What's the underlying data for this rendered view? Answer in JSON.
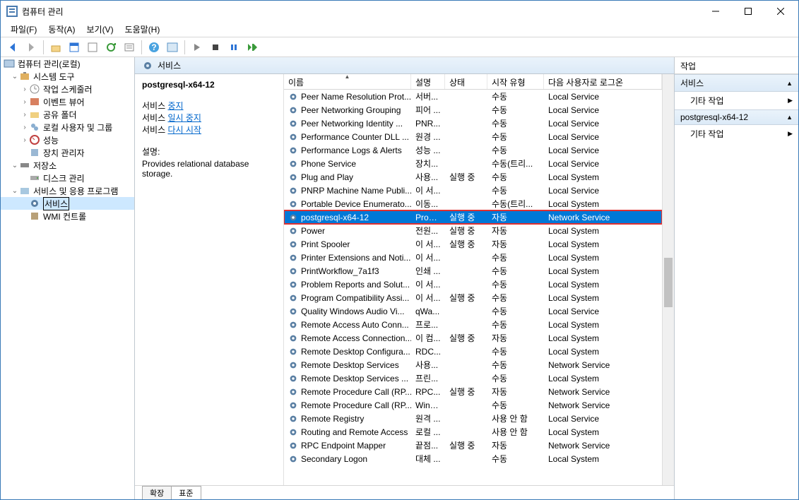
{
  "window": {
    "title": "컴퓨터 관리"
  },
  "menubar": [
    "파일(F)",
    "동작(A)",
    "보기(V)",
    "도움말(H)"
  ],
  "tree": {
    "root": "컴퓨터 관리(로컬)",
    "system_tools": "시스템 도구",
    "task_scheduler": "작업 스케줄러",
    "event_viewer": "이벤트 뷰어",
    "shared_folders": "공유 폴더",
    "local_users": "로컬 사용자 및 그룹",
    "performance": "성능",
    "device_mgr": "장치 관리자",
    "storage": "저장소",
    "disk_mgmt": "디스크 관리",
    "services_apps": "서비스 및 응용 프로그램",
    "services": "서비스",
    "wmi": "WMI 컨트롤"
  },
  "center": {
    "header": "서비스",
    "selected_name": "postgresql-x64-12",
    "service_label": "서비스",
    "stop": "중지",
    "pause": "일시 중지",
    "restart": "다시 시작",
    "desc_label": "설명:",
    "desc_text": "Provides relational database storage."
  },
  "columns": {
    "name": "이름",
    "desc": "설명",
    "status": "상태",
    "startup": "시작 유형",
    "logon": "다음 사용자로 로그온"
  },
  "tabs": {
    "extended": "확장",
    "standard": "표준"
  },
  "actions": {
    "header": "작업",
    "group1": "서비스",
    "other_actions": "기타 작업",
    "group2": "postgresql-x64-12"
  },
  "rows": [
    {
      "name": "Peer Name Resolution Prot...",
      "desc": "서버...",
      "status": "",
      "startup": "수동",
      "logon": "Local Service"
    },
    {
      "name": "Peer Networking Grouping",
      "desc": "피어 ...",
      "status": "",
      "startup": "수동",
      "logon": "Local Service"
    },
    {
      "name": "Peer Networking Identity ...",
      "desc": "PNR...",
      "status": "",
      "startup": "수동",
      "logon": "Local Service"
    },
    {
      "name": "Performance Counter DLL ...",
      "desc": "원경 ...",
      "status": "",
      "startup": "수동",
      "logon": "Local Service"
    },
    {
      "name": "Performance Logs & Alerts",
      "desc": "성능 ...",
      "status": "",
      "startup": "수동",
      "logon": "Local Service"
    },
    {
      "name": "Phone Service",
      "desc": "장치...",
      "status": "",
      "startup": "수동(트리...",
      "logon": "Local Service"
    },
    {
      "name": "Plug and Play",
      "desc": "사용...",
      "status": "실행 중",
      "startup": "수동",
      "logon": "Local System"
    },
    {
      "name": "PNRP Machine Name Publi...",
      "desc": "이 서...",
      "status": "",
      "startup": "수동",
      "logon": "Local Service"
    },
    {
      "name": "Portable Device Enumerato...",
      "desc": "이동...",
      "status": "",
      "startup": "수동(트리...",
      "logon": "Local System"
    },
    {
      "name": "postgresql-x64-12",
      "desc": "Provi...",
      "status": "실행 중",
      "startup": "자동",
      "logon": "Network Service",
      "selected": true,
      "red": true
    },
    {
      "name": "Power",
      "desc": "전원...",
      "status": "실행 중",
      "startup": "자동",
      "logon": "Local System"
    },
    {
      "name": "Print Spooler",
      "desc": "이 서...",
      "status": "실행 중",
      "startup": "자동",
      "logon": "Local System"
    },
    {
      "name": "Printer Extensions and Noti...",
      "desc": "이 서...",
      "status": "",
      "startup": "수동",
      "logon": "Local System"
    },
    {
      "name": "PrintWorkflow_7a1f3",
      "desc": "인쇄 ...",
      "status": "",
      "startup": "수동",
      "logon": "Local System"
    },
    {
      "name": "Problem Reports and Solut...",
      "desc": "이 서...",
      "status": "",
      "startup": "수동",
      "logon": "Local System"
    },
    {
      "name": "Program Compatibility Assi...",
      "desc": "이 서...",
      "status": "실행 중",
      "startup": "수동",
      "logon": "Local System"
    },
    {
      "name": "Quality Windows Audio Vi...",
      "desc": "qWa...",
      "status": "",
      "startup": "수동",
      "logon": "Local Service"
    },
    {
      "name": "Remote Access Auto Conn...",
      "desc": "프로...",
      "status": "",
      "startup": "수동",
      "logon": "Local System"
    },
    {
      "name": "Remote Access Connection...",
      "desc": "이 컴...",
      "status": "실행 중",
      "startup": "자동",
      "logon": "Local System"
    },
    {
      "name": "Remote Desktop Configura...",
      "desc": "RDC...",
      "status": "",
      "startup": "수동",
      "logon": "Local System"
    },
    {
      "name": "Remote Desktop Services",
      "desc": "사용...",
      "status": "",
      "startup": "수동",
      "logon": "Network Service"
    },
    {
      "name": "Remote Desktop Services ...",
      "desc": "프린...",
      "status": "",
      "startup": "수동",
      "logon": "Local System"
    },
    {
      "name": "Remote Procedure Call (RP...",
      "desc": "RPC...",
      "status": "실행 중",
      "startup": "자동",
      "logon": "Network Service"
    },
    {
      "name": "Remote Procedure Call (RP...",
      "desc": "Wind...",
      "status": "",
      "startup": "수동",
      "logon": "Network Service"
    },
    {
      "name": "Remote Registry",
      "desc": "원격 ...",
      "status": "",
      "startup": "사용 안 함",
      "logon": "Local Service"
    },
    {
      "name": "Routing and Remote Access",
      "desc": "로컬 ...",
      "status": "",
      "startup": "사용 안 함",
      "logon": "Local System"
    },
    {
      "name": "RPC Endpoint Mapper",
      "desc": "끝점...",
      "status": "실행 중",
      "startup": "자동",
      "logon": "Network Service"
    },
    {
      "name": "Secondary Logon",
      "desc": "대체 ...",
      "status": "",
      "startup": "수동",
      "logon": "Local System"
    }
  ]
}
